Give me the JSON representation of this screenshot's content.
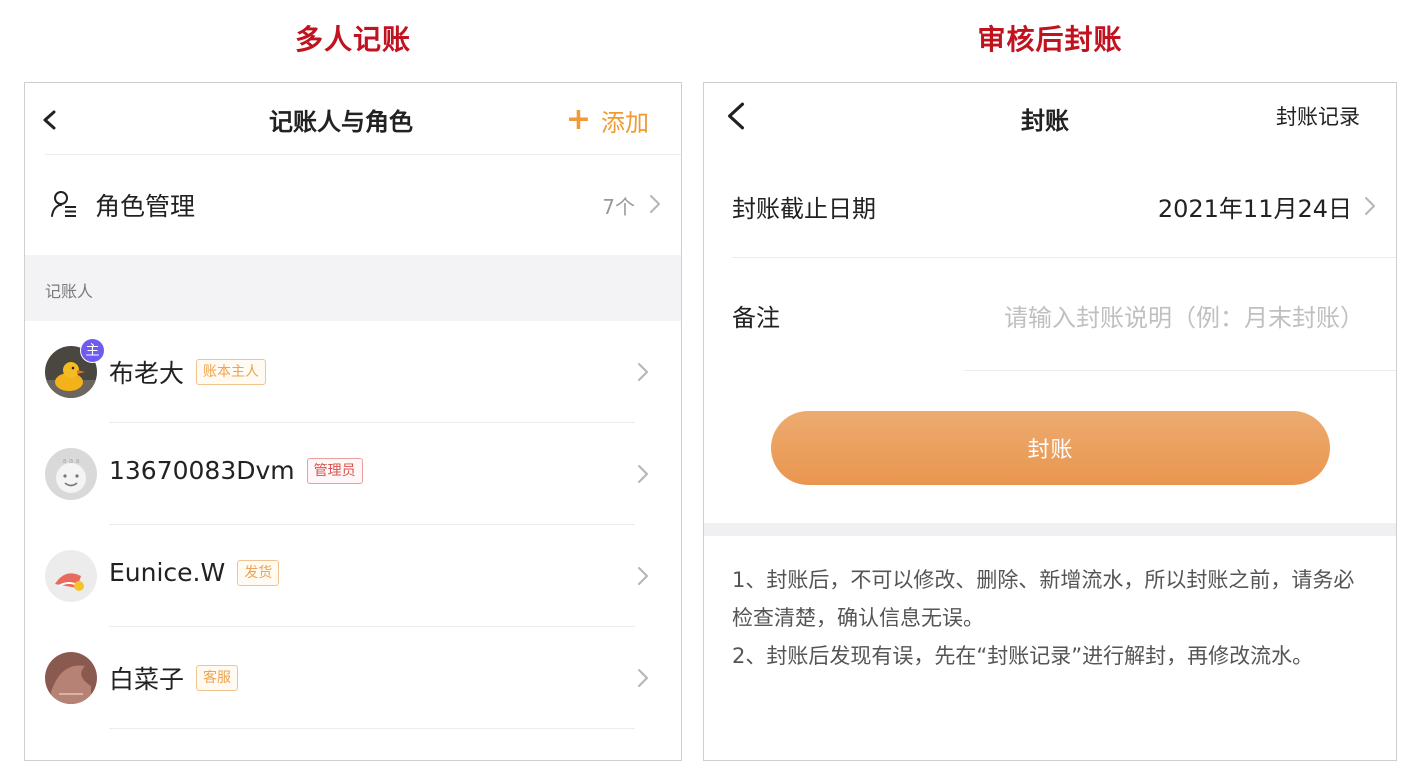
{
  "captions": {
    "left": "多人记账",
    "right": "审核后封账"
  },
  "left_screen": {
    "title": "记账人与角色",
    "add_icon": "plus-icon",
    "add_label": "添加",
    "role_management": {
      "icon": "user-roles-icon",
      "label": "角色管理",
      "count": "7个"
    },
    "section_label": "记账人",
    "members": [
      {
        "name": "布老大",
        "tag": "账本主人",
        "tag_style": "orange",
        "owner_badge": "主",
        "avatar": "duck-avatar"
      },
      {
        "name": "13670083Dvm",
        "tag": "管理员",
        "tag_style": "red",
        "avatar": "cartoon-face-avatar"
      },
      {
        "name": "Eunice.W",
        "tag": "发货",
        "tag_style": "orange",
        "avatar": "illustration-avatar"
      },
      {
        "name": "白菜子",
        "tag": "客服",
        "tag_style": "orange",
        "avatar": "photo-avatar"
      }
    ]
  },
  "right_screen": {
    "title": "封账",
    "record_link": "封账记录",
    "cutoff_label": "封账截止日期",
    "cutoff_value": "2021年11月24日",
    "remark_label": "备注",
    "remark_placeholder": "请输入封账说明（例：月末封账）",
    "seal_button": "封账",
    "notes": [
      "1、封账后，不可以修改、删除、新增流水，所以封账之前，请务必检查清楚，确认信息无误。",
      "2、封账后发现有误，先在“封账记录”进行解封，再修改流水。"
    ]
  },
  "colors": {
    "accent": "#ee9b35",
    "caption": "#c0121f",
    "button": "#e9964f",
    "badge": "#6e5cf0"
  }
}
